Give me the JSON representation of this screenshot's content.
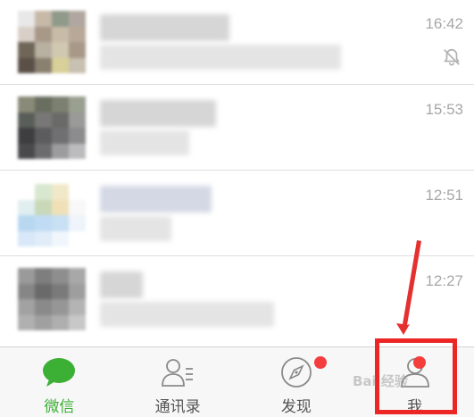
{
  "chats": [
    {
      "time": "16:42",
      "muted": true
    },
    {
      "time": "15:53",
      "muted": false
    },
    {
      "time": "12:51",
      "muted": false
    },
    {
      "time": "12:27",
      "muted": false
    }
  ],
  "tabs": [
    {
      "label": "微信",
      "icon": "chat-bubble-icon",
      "active": true,
      "badge": false
    },
    {
      "label": "通讯录",
      "icon": "contacts-icon",
      "active": false,
      "badge": false
    },
    {
      "label": "发现",
      "icon": "compass-icon",
      "active": false,
      "badge": true
    },
    {
      "label": "我",
      "icon": "person-icon",
      "active": false,
      "badge": true
    }
  ],
  "watermark": "Bai 经验",
  "colors": {
    "accent": "#3cb034",
    "badge": "#f43d3d",
    "annotation": "#ec2525",
    "time_text": "#a7a7a7"
  }
}
